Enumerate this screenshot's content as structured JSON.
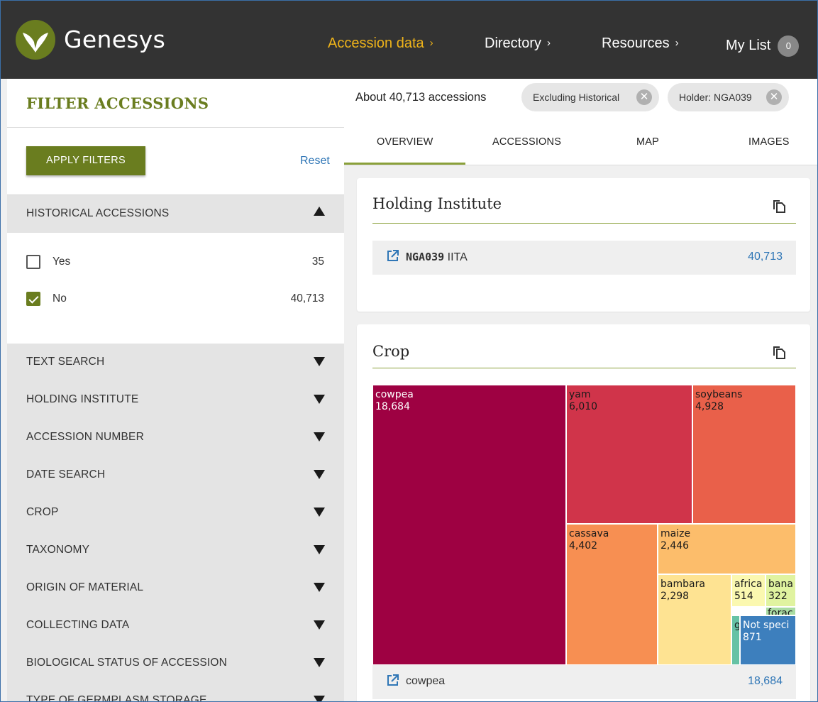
{
  "header": {
    "brand": "Genesys",
    "logo": "genesys-leaf-logo",
    "nav": [
      {
        "label": "Accession data",
        "chevron": "›",
        "active": true
      },
      {
        "label": "Directory",
        "chevron": "›",
        "active": false
      },
      {
        "label": "Resources",
        "chevron": "›",
        "active": false
      },
      {
        "label": "My List",
        "badge": "0"
      }
    ]
  },
  "sidebar": {
    "title": "FILTER ACCESSIONS",
    "apply_label": "APPLY FILTERS",
    "reset_label": "Reset",
    "historical": {
      "label": "HISTORICAL ACCESSIONS",
      "expanded": true,
      "options": [
        {
          "label": "Yes",
          "count": "35",
          "checked": false
        },
        {
          "label": "No",
          "count": "40,713",
          "checked": true
        }
      ]
    },
    "sections": [
      "TEXT SEARCH",
      "HOLDING INSTITUTE",
      "ACCESSION NUMBER",
      "DATE SEARCH",
      "CROP",
      "TAXONOMY",
      "ORIGIN OF MATERIAL",
      "COLLECTING DATA",
      "BIOLOGICAL STATUS OF ACCESSION",
      "TYPE OF GERMPLASM STORAGE"
    ]
  },
  "summary": {
    "count_text": "About 40,713 accessions",
    "chips": [
      "Excluding Historical",
      "Holder: NGA039"
    ]
  },
  "tabs": [
    "OVERVIEW",
    "ACCESSIONS",
    "MAP",
    "IMAGES"
  ],
  "holding_card": {
    "title": "Holding Institute",
    "code": "NGA039",
    "name": "IITA",
    "count": "40,713"
  },
  "crop_card": {
    "title": "Crop",
    "selected": {
      "label": "cowpea",
      "count": "18,684"
    }
  },
  "colors": {
    "header_bg": "#333333",
    "nav_active": "#eeb31a",
    "brand_green": "#6a7d1f",
    "link_blue": "#2f76b6"
  },
  "chart_data": {
    "type": "treemap",
    "title": "Crop",
    "items": [
      {
        "label": "cowpea",
        "value": 18684,
        "display": "18,684",
        "color": "#9e0142"
      },
      {
        "label": "yam",
        "value": 6010,
        "display": "6,010",
        "color": "#d0344a"
      },
      {
        "label": "soybeans",
        "value": 4928,
        "display": "4,928",
        "color": "#e9604a"
      },
      {
        "label": "cassava",
        "value": 4402,
        "display": "4,402",
        "color": "#f78f52"
      },
      {
        "label": "maize",
        "value": 2446,
        "display": "2,446",
        "color": "#fcbd6b"
      },
      {
        "label": "bambara",
        "value": 2298,
        "display": "2,298",
        "color": "#fee392"
      },
      {
        "label": "africa",
        "value": 514,
        "display": "514",
        "color": "#fbf8b0"
      },
      {
        "label": "bana",
        "value": 322,
        "display": "322",
        "color": "#e0f3a0"
      },
      {
        "label": "forac",
        "value": null,
        "display": "",
        "color": "#a9dca2"
      },
      {
        "label": "g",
        "value": null,
        "display": "",
        "color": "#66c2a5"
      },
      {
        "label": "Not speci",
        "value": 871,
        "display": "871",
        "color": "#3d7fbd"
      }
    ]
  }
}
